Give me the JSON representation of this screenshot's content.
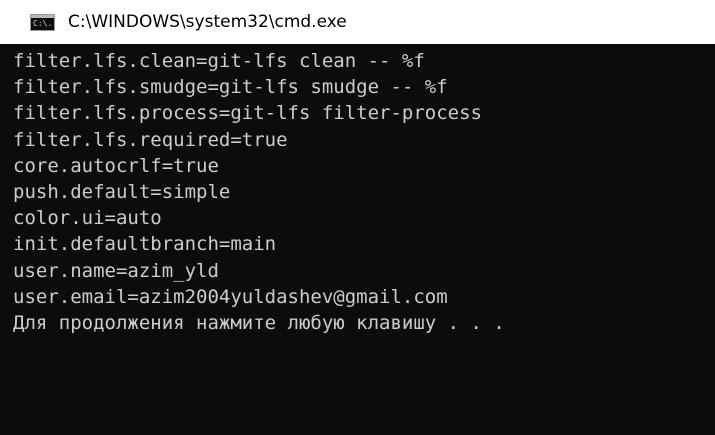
{
  "window": {
    "title": "C:\\WINDOWS\\system32\\cmd.exe",
    "icon": "cmd-icon",
    "icon_glyph": "C:\\."
  },
  "console": {
    "lines": [
      "filter.lfs.clean=git-lfs clean -- %f",
      "filter.lfs.smudge=git-lfs smudge -- %f",
      "filter.lfs.process=git-lfs filter-process",
      "filter.lfs.required=true",
      "core.autocrlf=true",
      "push.default=simple",
      "color.ui=auto",
      "init.defaultbranch=main",
      "user.name=azim_yld",
      "user.email=azim2004yuldashev@gmail.com",
      "Для продолжения нажмите любую клавишу . . ."
    ]
  },
  "colors": {
    "console_bg": "#0c0c0c",
    "console_fg": "#cccccc",
    "titlebar_bg": "#ffffff"
  }
}
